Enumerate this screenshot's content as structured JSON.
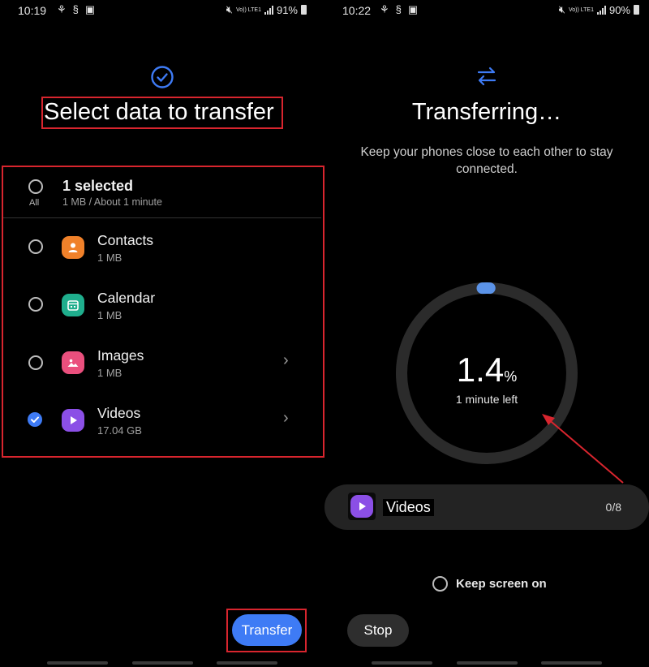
{
  "left_screen": {
    "status": {
      "time": "10:19",
      "battery": "91%",
      "network": "Vo)) LTE1"
    },
    "title": "Select data to transfer",
    "all_row": {
      "label": "1 selected",
      "sub": "1 MB / About 1 minute",
      "all_text": "All"
    },
    "items": [
      {
        "label": "Contacts",
        "size": "1 MB",
        "icon": "contacts-icon",
        "color": "#f0812a",
        "checked": false,
        "chevron": false
      },
      {
        "label": "Calendar",
        "size": "1 MB",
        "icon": "calendar-icon",
        "color": "#1fae8d",
        "checked": false,
        "chevron": false
      },
      {
        "label": "Images",
        "size": "1 MB",
        "icon": "images-icon",
        "color": "#ea4f7d",
        "checked": false,
        "chevron": true
      },
      {
        "label": "Videos",
        "size": "17.04 GB",
        "icon": "videos-icon",
        "color": "#8b4fe6",
        "checked": true,
        "chevron": true
      }
    ],
    "transfer_button": "Transfer"
  },
  "right_screen": {
    "status": {
      "time": "10:22",
      "battery": "90%",
      "network": "Vo)) LTE1"
    },
    "title": "Transferring…",
    "subtitle": "Keep your phones close to each other to stay connected.",
    "progress": {
      "value": "1.4",
      "unit": "%",
      "time_left": "1 minute left",
      "fraction": 0.014
    },
    "current_item": {
      "label": "Videos",
      "count": "0/8"
    },
    "keep_screen_on": "Keep screen on",
    "stop_button": "Stop"
  },
  "colors": {
    "accent": "#3e7bf5",
    "annotation": "#d8252e",
    "background": "#000000"
  }
}
